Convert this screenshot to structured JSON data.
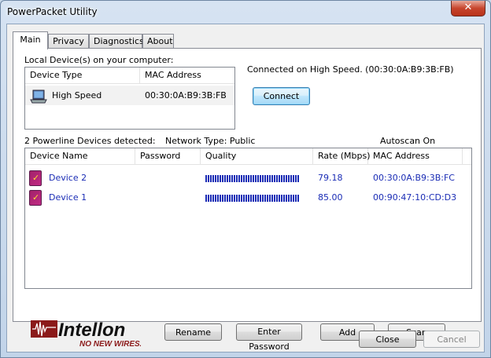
{
  "window": {
    "title": "PowerPacket Utility",
    "close_glyph": "✕"
  },
  "tabs": [
    {
      "label": "Main",
      "active": true
    },
    {
      "label": "Privacy",
      "active": false
    },
    {
      "label": "Diagnostics",
      "active": false
    },
    {
      "label": "About",
      "active": false
    }
  ],
  "local": {
    "section_label": "Local Device(s) on your computer:",
    "columns": [
      "Device Type",
      "MAC Address"
    ],
    "rows": [
      {
        "icon": "laptop-icon",
        "type": "High Speed",
        "mac": "00:30:0A:B9:3B:FB"
      }
    ],
    "connected_text": "Connected on  High Speed. (00:30:0A:B9:3B:FB)",
    "connect_label": "Connect"
  },
  "powerline": {
    "detected_label": "2 Powerline Devices detected:",
    "network_type": "Network Type: Public",
    "autoscan": "Autoscan On",
    "columns": [
      "Device Name",
      "Password",
      "Quality",
      "Rate (Mbps)",
      "MAC Address"
    ],
    "rows": [
      {
        "icon": "powerline-device-icon",
        "name": "Device 2",
        "password": "",
        "quality": 1.0,
        "rate": "79.18",
        "mac": "00:30:0A:B9:3B:FC"
      },
      {
        "icon": "powerline-device-icon",
        "name": "Device 1",
        "password": "",
        "quality": 1.0,
        "rate": "85.00",
        "mac": "00:90:47:10:CD:D3"
      }
    ]
  },
  "logo": {
    "brand": "Intellon",
    "tagline": "NO NEW WIRES."
  },
  "actions": {
    "rename": "Rename",
    "enter_password": "Enter Password",
    "add": "Add",
    "scan": "Scan"
  },
  "footer": {
    "close": "Close",
    "cancel": "Cancel"
  },
  "colors": {
    "accent_blue": "#1a2cb5",
    "brand_red": "#8b1a1a",
    "device_icon": "#b0267a"
  }
}
